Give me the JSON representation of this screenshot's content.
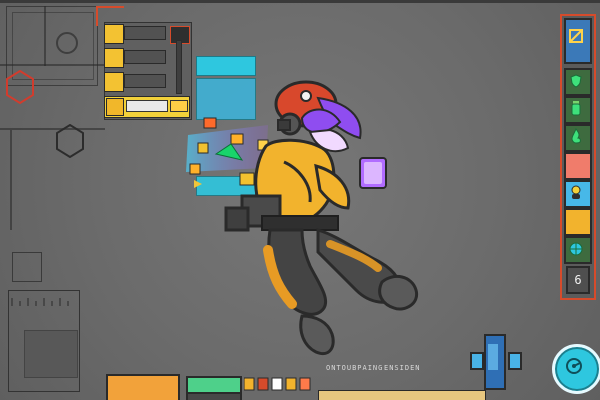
{
  "scene": {
    "bottom_bar": {
      "text_left": "ONTOUBPAING",
      "text_right": "ENSIDEN"
    },
    "right_dock_badge": "6"
  },
  "colors": {
    "accent_red": "#d64b2b",
    "accent_cyan": "#2ec7df",
    "accent_yellow": "#f2c12f",
    "accent_purple": "#a65bff",
    "panel_blue": "#3b79b8",
    "ui_dark": "#2a2a2a"
  },
  "icons": [
    "grid-toggle-icon",
    "character-head-icon",
    "gear-bottle-icon",
    "shield-icon",
    "flame-icon",
    "globe-icon",
    "radar-icon"
  ]
}
